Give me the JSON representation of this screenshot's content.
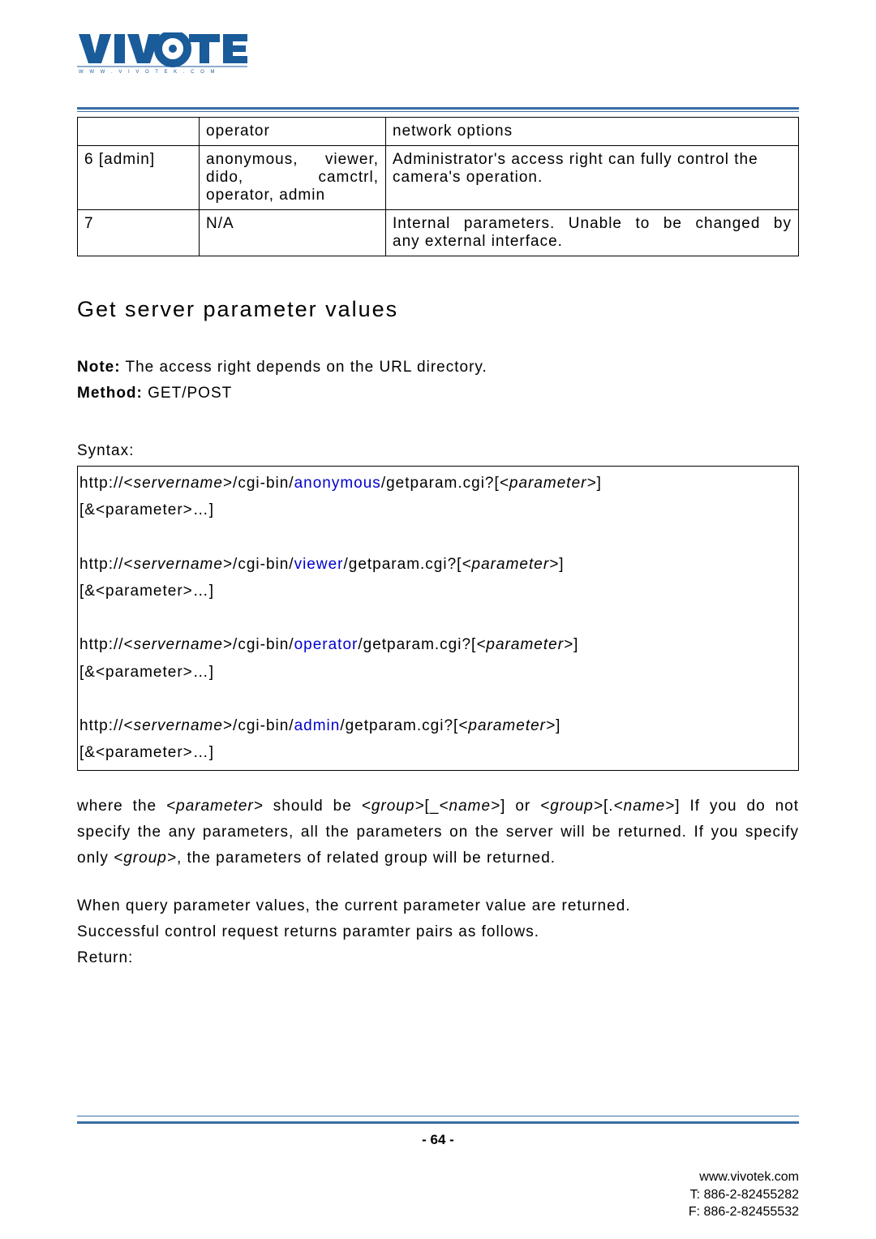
{
  "logo": {
    "brand": "VIVOTEK",
    "url_text": "www.vivotek.com"
  },
  "table": {
    "rows": [
      {
        "c1": "",
        "c2": "operator",
        "c3": "network options"
      },
      {
        "c1": "6 [admin]",
        "c2": "anonymous, viewer, dido, camctrl, operator, admin",
        "c3": "Administrator's access right can fully control the camera's operation."
      },
      {
        "c1": "7",
        "c2": "N/A",
        "c3": "Internal parameters. Unable to be changed by any external interface."
      }
    ]
  },
  "section_title": "Get server parameter values",
  "note_label": "Note:",
  "note_text": " The access right depends on the URL directory.",
  "method_label": "Method:",
  "method_text": " GET/POST",
  "syntax_label": "Syntax:",
  "syntax": {
    "l1a": "http://<",
    "servername": "servername",
    "l1b": ">/cgi-bin/",
    "anonymous": "anonymous",
    "l1c": "/getparam.cgi?[",
    "param": "<parameter>",
    "l1d": "]",
    "l2": "[&<parameter>…]",
    "viewer": "viewer",
    "operator": "operator",
    "admin": "admin"
  },
  "para1a": "where the ",
  "para1_it1": "<parameter>",
  "para1b": " should be ",
  "para1_it2": "<group>",
  "para1c": "[_",
  "para1_it3": "<name>",
  "para1d": "] or ",
  "para1_it4": "<group>",
  "para1e": "[.",
  "para1_it5": "<name>",
  "para1f": "] If you do not specify the any parameters, all the parameters on the server will be returned. If you specify only ",
  "para1_it6": "<group>",
  "para1g": ", the parameters of related group will be returned.",
  "para2": "When query parameter values, the current parameter value are returned.",
  "para3": "Successful control request returns paramter pairs as follows.",
  "return_label": "Return:",
  "page_number": "- 64 -",
  "footer": {
    "url": "www.vivotek.com",
    "tel": "T: 886-2-82455282",
    "fax": "F: 886-2-82455532"
  }
}
